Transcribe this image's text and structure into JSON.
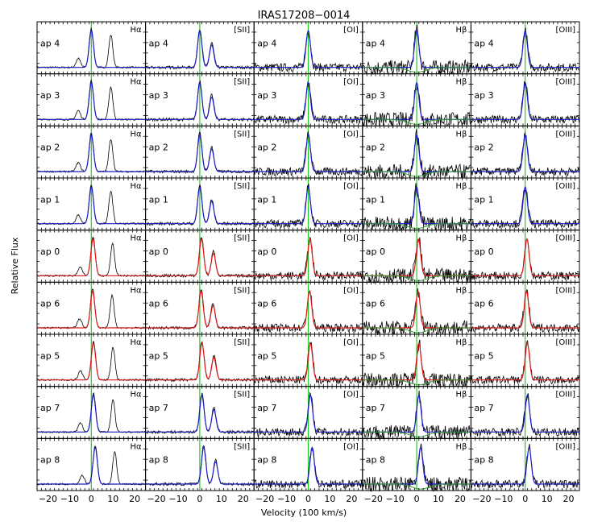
{
  "chart_data": {
    "type": "line",
    "title": "IRAS17208−0014",
    "xlabel": "Velocity (100 km/s)",
    "ylabel": "Relative Flux",
    "xlim": [
      -25,
      25
    ],
    "x_ticks": [
      -20,
      -10,
      0,
      10,
      20
    ],
    "tick_label_text": [
      "−20",
      "−10",
      "0",
      "10",
      "20"
    ],
    "lines": [
      "Hα",
      "[SII]",
      "[OI]",
      "Hβ",
      "[OIII]"
    ],
    "apertures": [
      "ap 4",
      "ap 3",
      "ap 2",
      "ap 1",
      "ap 0",
      "ap 6",
      "ap 5",
      "ap 7",
      "ap 8"
    ],
    "reference_velocity": 0,
    "colors": {
      "data": "#000000",
      "fit_blue": "#1c1cc8",
      "fit_red": "#e01818",
      "fit_green": "#2e9b2e",
      "zero_line": "#22cc22"
    },
    "fit_color_by_aperture": [
      "fit_blue",
      "fit_blue",
      "fit_blue",
      "fit_blue",
      "fit_red",
      "fit_red",
      "fit_red",
      "fit_blue",
      "fit_blue"
    ],
    "peak_velocity_by_aperture": [
      0,
      0,
      0,
      0,
      0.8,
      0.6,
      1.0,
      1.0,
      1.8
    ]
  }
}
